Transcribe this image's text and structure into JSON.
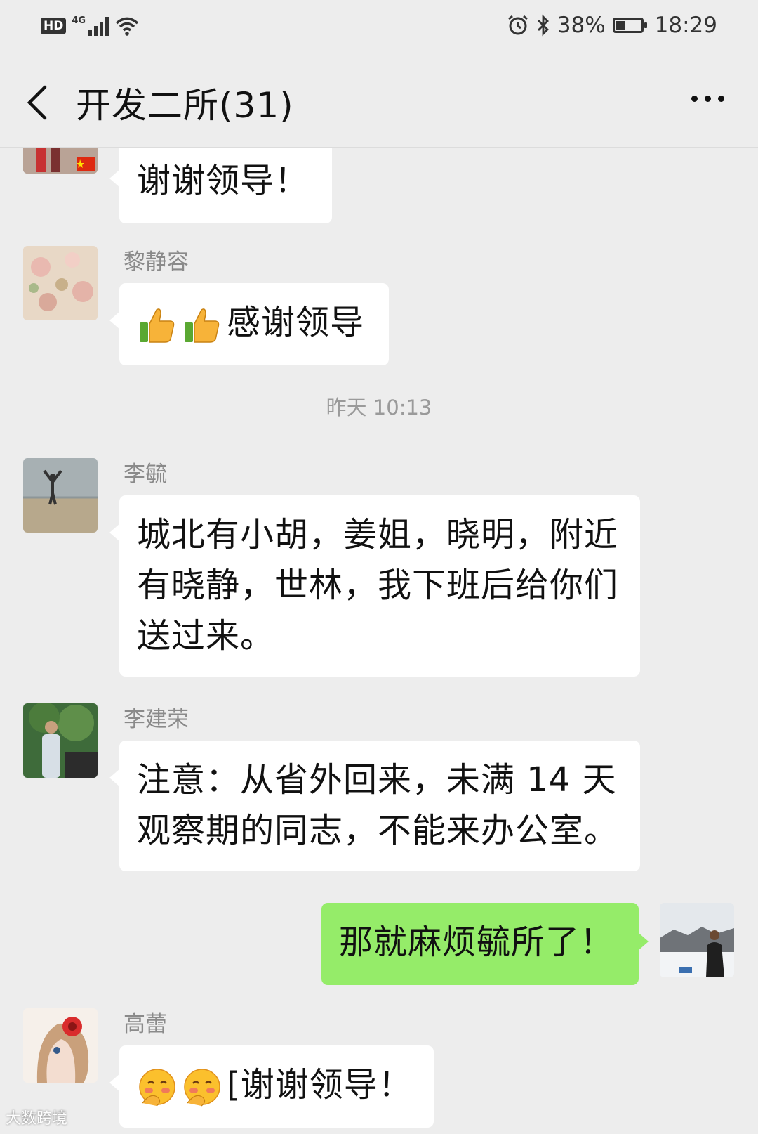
{
  "status_bar": {
    "hd": "HD",
    "network": "4G",
    "battery_percent": "38%",
    "battery_level": 0.38,
    "time": "18:29"
  },
  "header": {
    "title": "开发二所(31)"
  },
  "messages": [
    {
      "sender": "",
      "text": "谢谢领导！",
      "direction": "in"
    },
    {
      "sender": "黎静容",
      "text": "感谢领导",
      "emojis": [
        "thumbs-up",
        "thumbs-up"
      ],
      "direction": "in"
    },
    {
      "timestamp": "昨天 10:13"
    },
    {
      "sender": "李毓",
      "lines": [
        "城北有小胡，姜姐，晓明，附近",
        "有晓静，世林，我下班后给你们",
        "送过来。"
      ],
      "direction": "in"
    },
    {
      "sender": "李建荣",
      "lines": [
        "注意：从省外回来，未满 14 天",
        "观察期的同志，不能来办公室。"
      ],
      "direction": "in"
    },
    {
      "text": "那就麻烦毓所了！",
      "direction": "out"
    },
    {
      "sender": "高蕾",
      "text": "[谢谢领导！",
      "emojis": [
        "blush-face",
        "blush-face"
      ],
      "direction": "in"
    }
  ],
  "watermark": "大数跨境",
  "colors": {
    "background": "#ededed",
    "incoming_bubble": "#ffffff",
    "outgoing_bubble": "#95ec69"
  }
}
